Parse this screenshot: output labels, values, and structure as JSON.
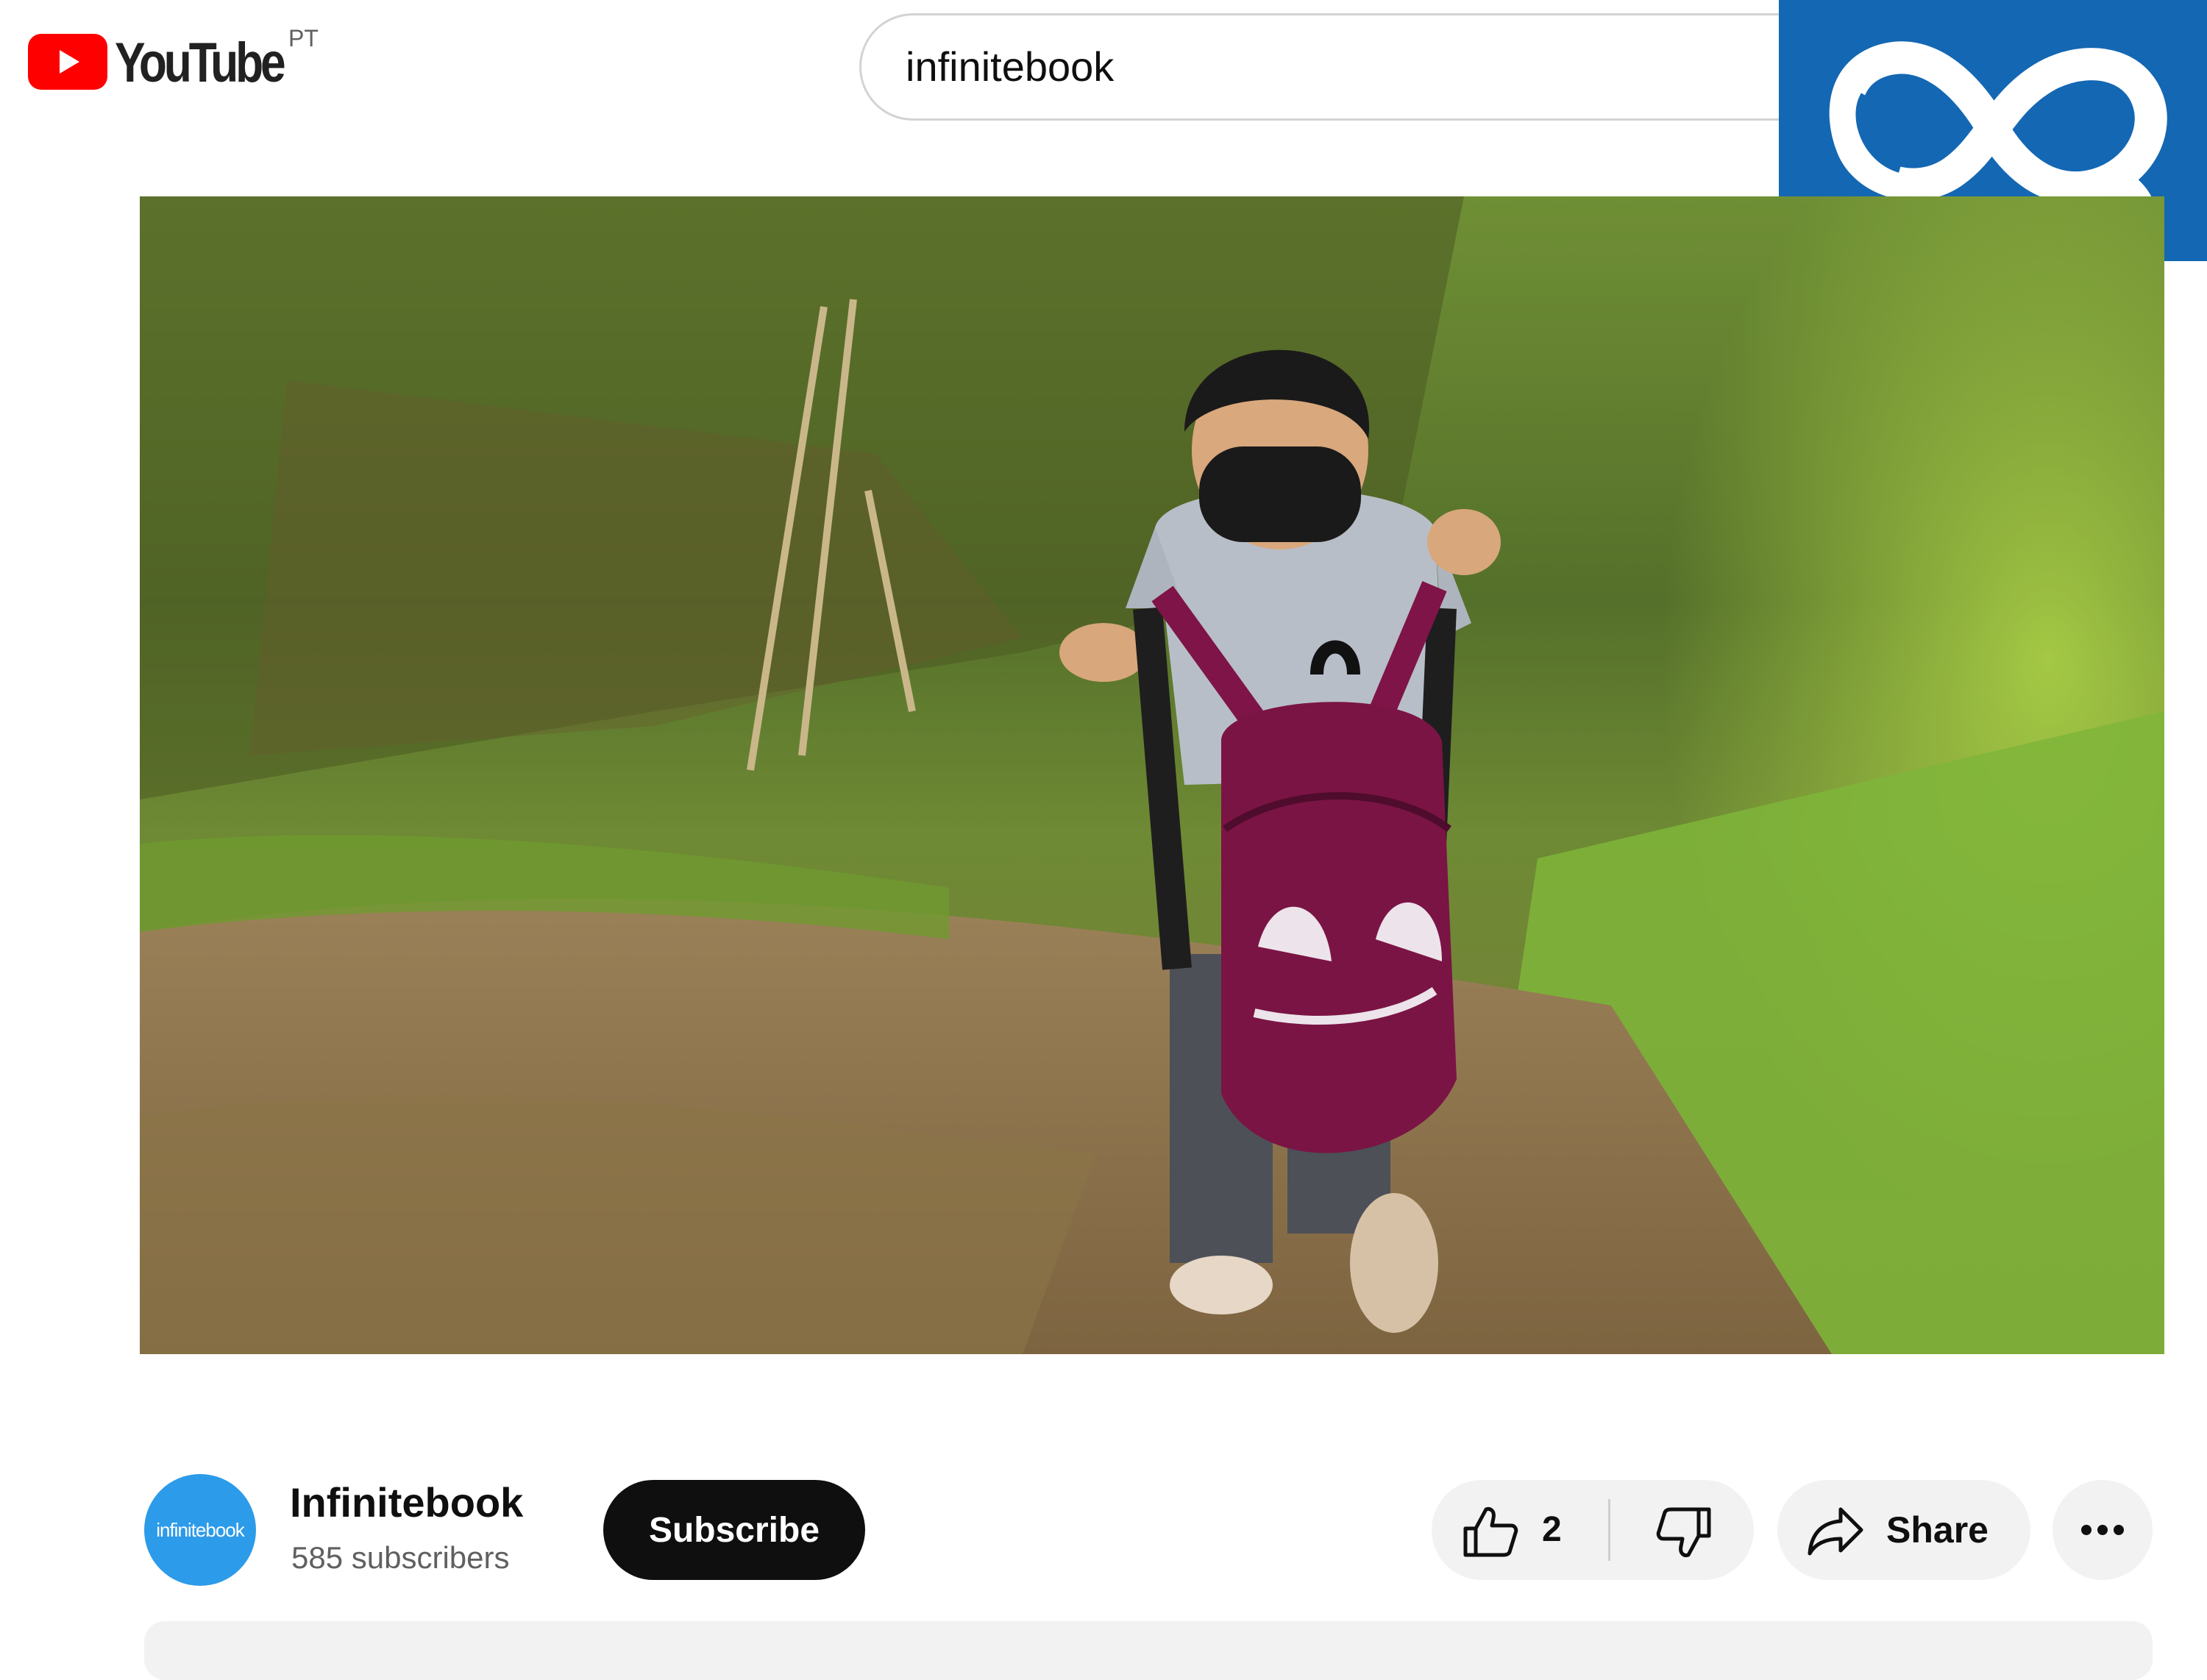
{
  "header": {
    "logo": {
      "text": "YouTube",
      "region": "PT",
      "icon": "youtube-play-icon"
    },
    "search": {
      "value": "infinitebook"
    },
    "channel_brand_overlay": {
      "icon": "infinity-logo-icon",
      "color": "#1467b3"
    }
  },
  "video": {
    "thumbnail_description": "child-with-backpack-on-dirt-path"
  },
  "channel": {
    "avatar_text": "infinitebook",
    "name": "Infinitebook",
    "subscribers": "585 subscribers",
    "subscribe_label": "Subscribe"
  },
  "actions": {
    "like_count": "2",
    "share_label": "Share",
    "more_icon": "more-horizontal-icon"
  },
  "colors": {
    "accent": "#ff0000",
    "brand_blue": "#1467b3",
    "avatar_blue": "#2c9be9",
    "button_dark": "#0f0f0f",
    "pill_gray": "#f2f2f2"
  }
}
